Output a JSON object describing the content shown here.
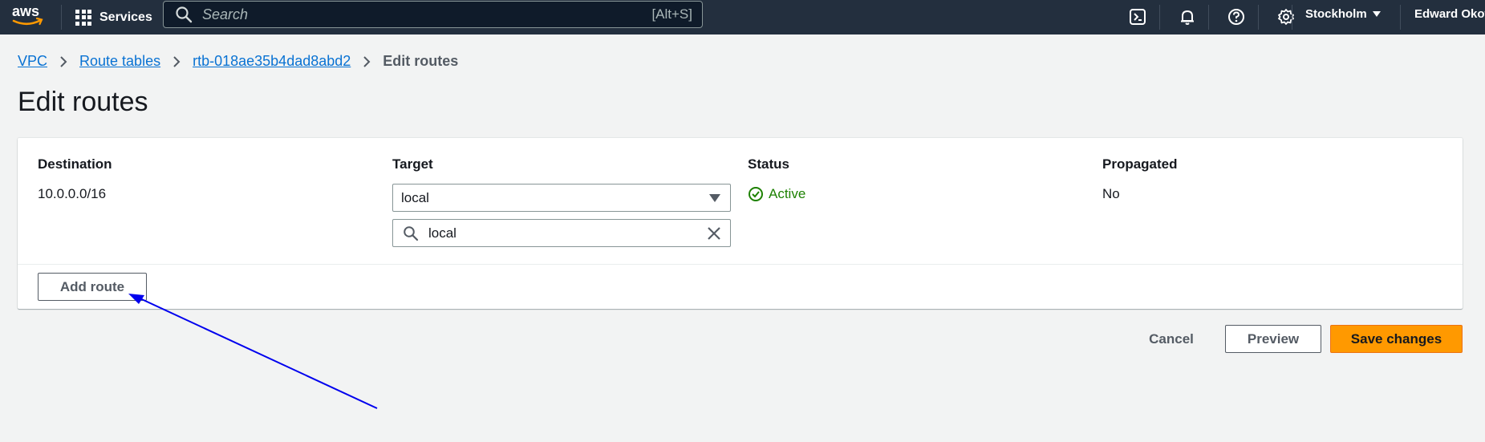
{
  "topnav": {
    "logo_text": "aws",
    "services_label": "Services",
    "search_placeholder": "Search",
    "search_shortcut": "[Alt+S]",
    "region": "Stockholm",
    "user": "Edward Okot",
    "icons": [
      "cloudshell-icon",
      "bell-icon",
      "help-icon",
      "gear-icon"
    ]
  },
  "breadcrumb": {
    "items": [
      "VPC",
      "Route tables",
      "rtb-018ae35b4dad8abd2"
    ],
    "current": "Edit routes"
  },
  "page": {
    "title": "Edit routes"
  },
  "routes": {
    "headers": {
      "destination": "Destination",
      "target": "Target",
      "status": "Status",
      "propagated": "Propagated"
    },
    "rows": [
      {
        "destination": "10.0.0.0/16",
        "target": "local",
        "target_filter": "local",
        "status": "Active",
        "propagated": "No"
      }
    ],
    "add_route_label": "Add route"
  },
  "actions": {
    "cancel": "Cancel",
    "preview": "Preview",
    "save": "Save changes"
  },
  "colors": {
    "nav_bg": "#232f3e",
    "link": "#0972d3",
    "status_active": "#1d8102",
    "primary_button": "#ff9900",
    "annotation_arrow": "#0000ee"
  }
}
